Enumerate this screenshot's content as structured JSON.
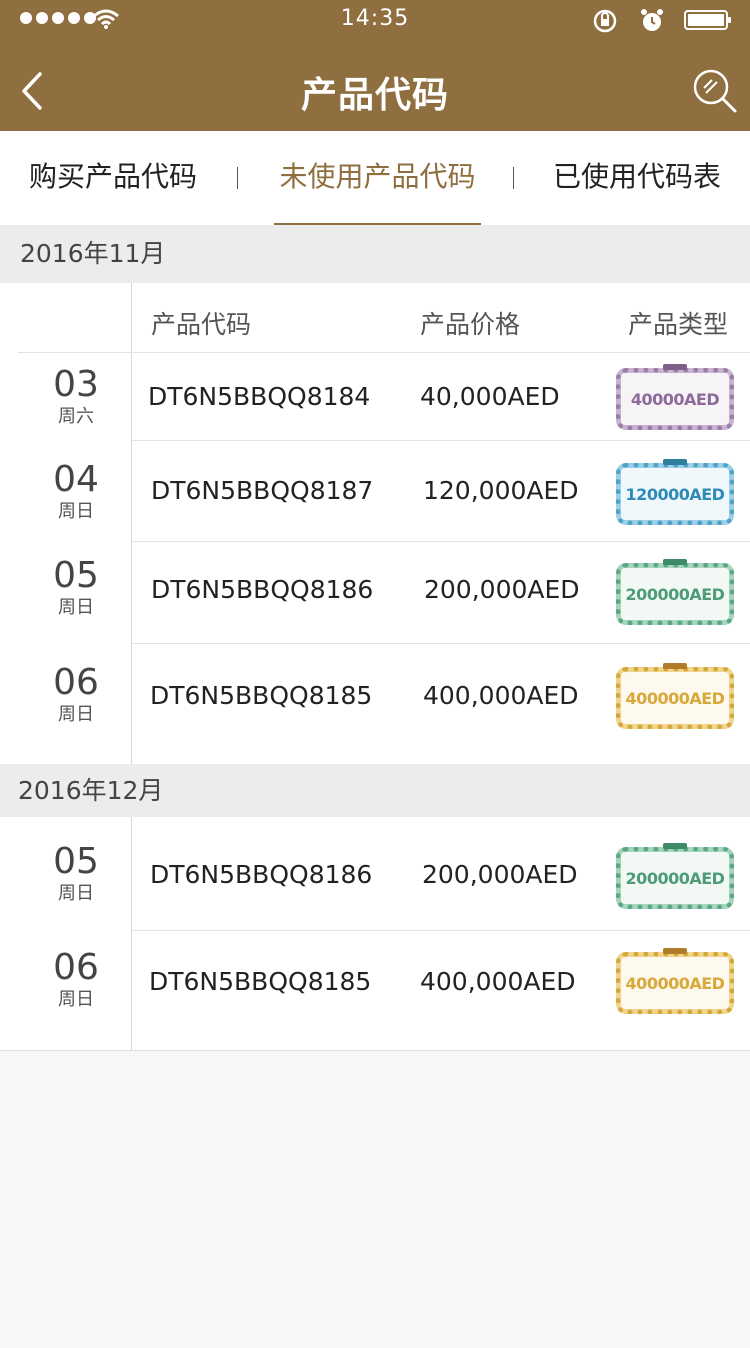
{
  "status_bar": {
    "time": "14:35"
  },
  "nav": {
    "title": "产品代码"
  },
  "tabs": [
    {
      "label": "购买产品代码",
      "active": false
    },
    {
      "label": "未使用产品代码",
      "active": true
    },
    {
      "label": "已使用代码表",
      "active": false
    }
  ],
  "colors": {
    "brand": "#8f6f3f",
    "active_tab": "#8f6f3f"
  },
  "table_headers": {
    "code": "产品代码",
    "price": "产品价格",
    "type": "产品类型"
  },
  "groups": [
    {
      "month": "2016年11月",
      "rows": [
        {
          "day": "03",
          "weekday": "周六",
          "code": "DT6N5BBQQ8184",
          "price": "40,000AED",
          "ticket": "40000AED",
          "ticket_color": "purple"
        },
        {
          "day": "04",
          "weekday": "周日",
          "code": "DT6N5BBQQ8187",
          "price": "120,000AED",
          "ticket": "120000AED",
          "ticket_color": "blue"
        },
        {
          "day": "05",
          "weekday": "周日",
          "code": "DT6N5BBQQ8186",
          "price": "200,000AED",
          "ticket": "200000AED",
          "ticket_color": "green"
        },
        {
          "day": "06",
          "weekday": "周日",
          "code": "DT6N5BBQQ8185",
          "price": "400,000AED",
          "ticket": "400000AED",
          "ticket_color": "gold"
        }
      ]
    },
    {
      "month": "2016年12月",
      "rows": [
        {
          "day": "05",
          "weekday": "周日",
          "code": "DT6N5BBQQ8186",
          "price": "200,000AED",
          "ticket": "200000AED",
          "ticket_color": "green"
        },
        {
          "day": "06",
          "weekday": "周日",
          "code": "DT6N5BBQQ8185",
          "price": "400,000AED",
          "ticket": "400000AED",
          "ticket_color": "gold"
        }
      ]
    }
  ]
}
